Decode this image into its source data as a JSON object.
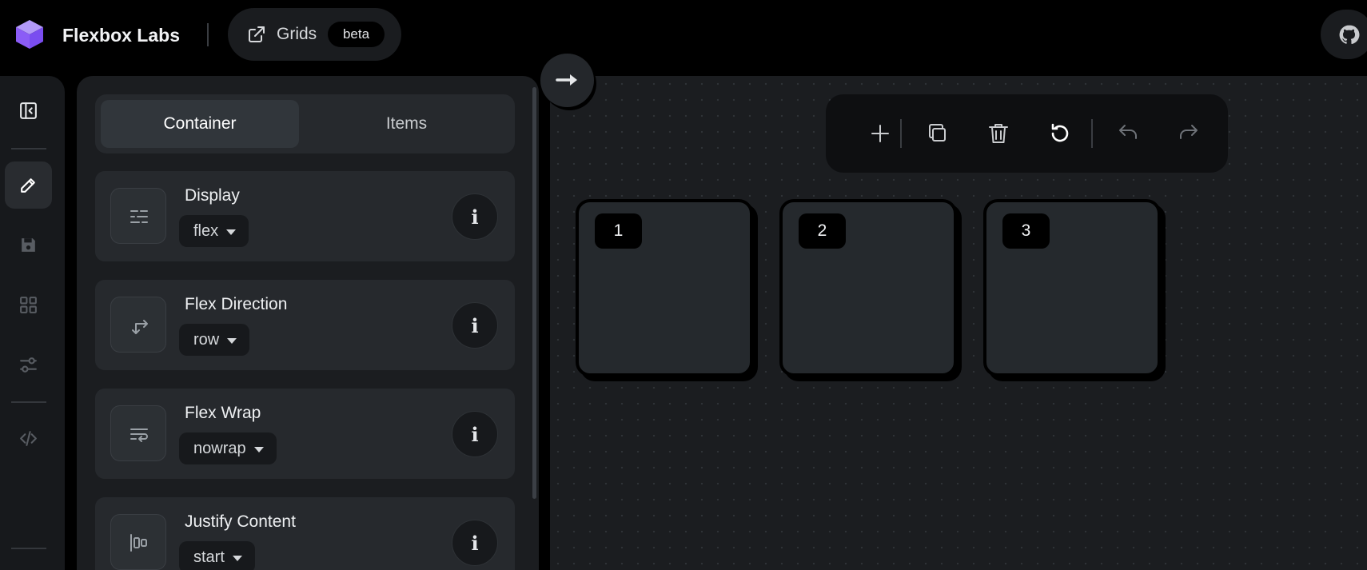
{
  "header": {
    "brand_name": "Flexbox Labs",
    "grids_link": {
      "label": "Grids",
      "badge": "beta"
    },
    "github_icon": "github-icon"
  },
  "rail": {
    "items": [
      {
        "name": "collapse-panel",
        "icon": "sidebar-collapse-icon"
      },
      {
        "name": "edit",
        "icon": "pencil-icon",
        "active": true
      },
      {
        "name": "save",
        "icon": "save-icon"
      },
      {
        "name": "layouts",
        "icon": "grid-icon"
      },
      {
        "name": "settings",
        "icon": "sliders-icon"
      },
      {
        "name": "code",
        "icon": "code-icon"
      }
    ]
  },
  "panel": {
    "tabs": [
      {
        "label": "Container",
        "active": true
      },
      {
        "label": "Items",
        "active": false
      }
    ],
    "properties": [
      {
        "label": "Display",
        "value": "flex",
        "icon": "display-icon"
      },
      {
        "label": "Flex Direction",
        "value": "row",
        "icon": "direction-arrows-icon"
      },
      {
        "label": "Flex Wrap",
        "value": "nowrap",
        "icon": "wrap-icon"
      },
      {
        "label": "Justify Content",
        "value": "start",
        "icon": "justify-start-icon"
      }
    ],
    "info_label": "i"
  },
  "toolbar": {
    "tools": [
      "plus-icon",
      "copy-icon",
      "trash-icon",
      "reset-icon",
      "undo-icon",
      "redo-icon"
    ]
  },
  "canvas": {
    "items": [
      {
        "label": "1"
      },
      {
        "label": "2"
      },
      {
        "label": "3"
      }
    ]
  },
  "colors": {
    "accent": "#8b5cf6",
    "background": "#000000",
    "panel": "#1b1d20",
    "card": "#26292d"
  }
}
